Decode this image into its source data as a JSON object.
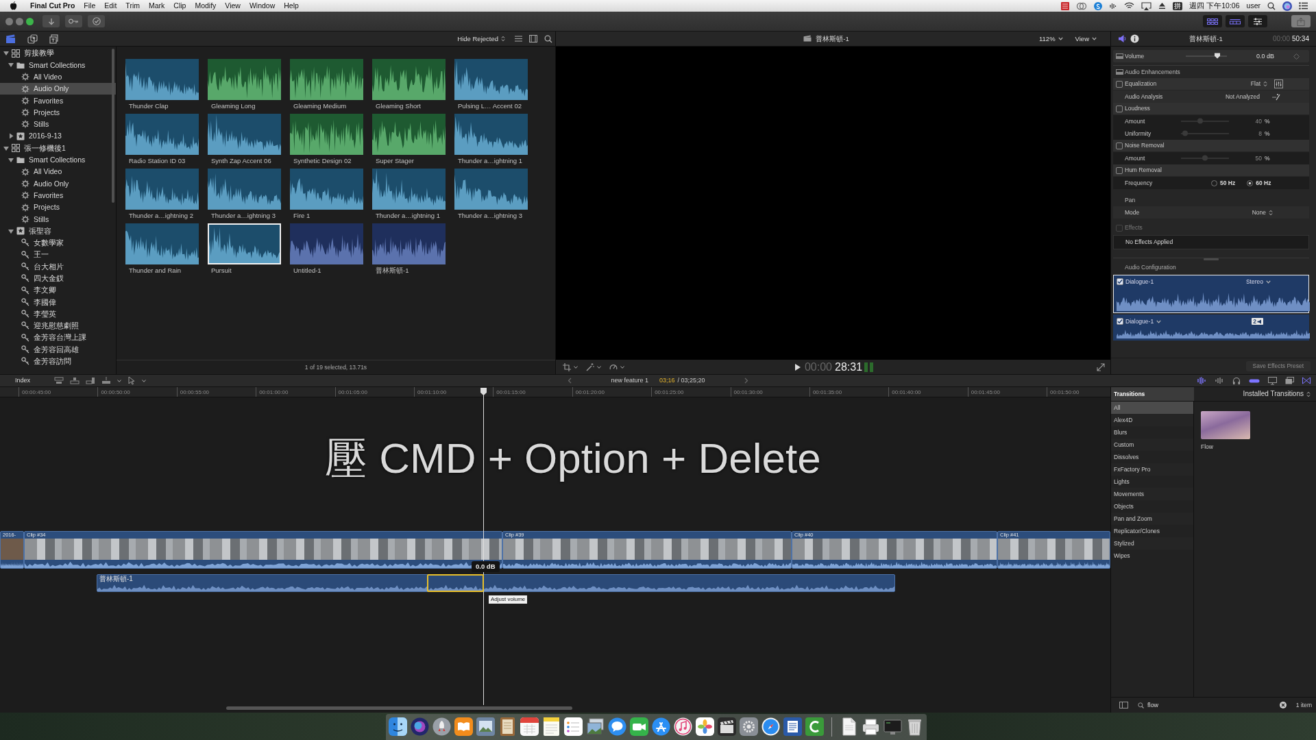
{
  "menu_bar": {
    "app_name": "Final Cut Pro",
    "menus": [
      "File",
      "Edit",
      "Trim",
      "Mark",
      "Clip",
      "Modify",
      "View",
      "Window",
      "Help"
    ],
    "input_method": "拼",
    "clock": "週四 下午10:06",
    "user": "user"
  },
  "libraries": [
    {
      "label": "剪接教學",
      "kind": "library",
      "expanded": true,
      "selected": false,
      "children": [
        {
          "label": "Smart Collections",
          "kind": "folder",
          "expanded": true,
          "selected": false,
          "children": [
            {
              "label": "All Video",
              "kind": "smart",
              "selected": false
            },
            {
              "label": "Audio Only",
              "kind": "smart",
              "selected": true
            },
            {
              "label": "Favorites",
              "kind": "smart",
              "selected": false
            },
            {
              "label": "Projects",
              "kind": "smart",
              "selected": false
            },
            {
              "label": "Stills",
              "kind": "smart",
              "selected": false
            }
          ]
        },
        {
          "label": "2016-9-13",
          "kind": "event",
          "expanded": false,
          "selected": false
        }
      ]
    },
    {
      "label": "張一修機後1",
      "kind": "library",
      "expanded": true,
      "selected": false,
      "children": [
        {
          "label": "Smart Collections",
          "kind": "folder",
          "expanded": true,
          "selected": false,
          "children": [
            {
              "label": "All Video",
              "kind": "smart",
              "selected": false
            },
            {
              "label": "Audio Only",
              "kind": "smart",
              "selected": false
            },
            {
              "label": "Favorites",
              "kind": "smart",
              "selected": false
            },
            {
              "label": "Projects",
              "kind": "smart",
              "selected": false
            },
            {
              "label": "Stills",
              "kind": "smart",
              "selected": false
            }
          ]
        },
        {
          "label": "張聖容",
          "kind": "event",
          "expanded": true,
          "selected": false,
          "children": [
            {
              "label": "女數學家",
              "kind": "keyword",
              "selected": false
            },
            {
              "label": "王一",
              "kind": "keyword",
              "selected": false
            },
            {
              "label": "台大相片",
              "kind": "keyword",
              "selected": false
            },
            {
              "label": "四大金釵",
              "kind": "keyword",
              "selected": false
            },
            {
              "label": "李文卿",
              "kind": "keyword",
              "selected": false
            },
            {
              "label": "李國偉",
              "kind": "keyword",
              "selected": false
            },
            {
              "label": "李瑩英",
              "kind": "keyword",
              "selected": false
            },
            {
              "label": "迎兆慰慈劇照",
              "kind": "keyword",
              "selected": false
            },
            {
              "label": "金芳容台灣上課",
              "kind": "keyword",
              "selected": false
            },
            {
              "label": "金芳容回高雄",
              "kind": "keyword",
              "selected": false
            },
            {
              "label": "金芳容訪問",
              "kind": "keyword",
              "selected": false
            }
          ]
        }
      ]
    }
  ],
  "browser": {
    "filter": "Hide Rejected",
    "clips": [
      {
        "name": "Thunder Clap",
        "kind": "effect",
        "selected": false
      },
      {
        "name": "Gleaming Long",
        "kind": "music",
        "selected": false
      },
      {
        "name": "Gleaming Medium",
        "kind": "music",
        "selected": false
      },
      {
        "name": "Gleaming Short",
        "kind": "music",
        "selected": false
      },
      {
        "name": "Pulsing L… Accent 02",
        "kind": "effect",
        "selected": false
      },
      {
        "name": "Radio Station ID 03",
        "kind": "effect",
        "selected": false
      },
      {
        "name": "Synth Zap Accent 06",
        "kind": "effect",
        "selected": false
      },
      {
        "name": "Synthetic Design 02",
        "kind": "music",
        "selected": false
      },
      {
        "name": "Super Stager",
        "kind": "music",
        "selected": false
      },
      {
        "name": "Thunder a…ightning 1",
        "kind": "effect",
        "selected": false
      },
      {
        "name": "Thunder a…ightning 2",
        "kind": "effect",
        "selected": false
      },
      {
        "name": "Thunder a…ightning 3",
        "kind": "effect",
        "selected": false
      },
      {
        "name": "Fire 1",
        "kind": "effect",
        "selected": false
      },
      {
        "name": "Thunder a…ightning 1",
        "kind": "effect",
        "selected": false
      },
      {
        "name": "Thunder a…ightning 3",
        "kind": "effect",
        "selected": false
      },
      {
        "name": "Thunder and Rain",
        "kind": "effect",
        "selected": false
      },
      {
        "name": "Pursuit",
        "kind": "effect",
        "selected": true
      },
      {
        "name": "Untitled-1",
        "kind": "project",
        "selected": false
      },
      {
        "name": "普林斯頓-1",
        "kind": "project",
        "selected": false
      }
    ],
    "status": "1 of 19 selected, 13.71s"
  },
  "viewer": {
    "title": "普林斯頓-1",
    "zoom": "112%",
    "view_menu": "View",
    "timecode_prefix": "00:00",
    "timecode": "28:31"
  },
  "inspector": {
    "title": "普林斯頓-1",
    "timecode_prefix": "00:00",
    "timecode": "50:34",
    "volume": {
      "label": "Volume",
      "level": 0.77,
      "reading": "0.0 dB"
    },
    "rows": [
      {
        "kind": "section",
        "label": "Audio Enhancements",
        "collapsible": true
      },
      {
        "kind": "check",
        "label": "Equalization",
        "checked": false,
        "disabled": false,
        "value": "Flat"
      },
      {
        "kind": "info",
        "label": "Audio Analysis",
        "value": "Not Analyzed"
      },
      {
        "kind": "check",
        "label": "Loudness",
        "checked": false,
        "disabled": false
      },
      {
        "kind": "slider",
        "label": "Amount",
        "level": 0.4,
        "value": "40",
        "unit": "%"
      },
      {
        "kind": "slider",
        "label": "Uniformity",
        "level": 0.08,
        "value": "8",
        "unit": "%"
      },
      {
        "kind": "check",
        "label": "Noise Removal",
        "checked": false,
        "disabled": false
      },
      {
        "kind": "slider",
        "label": "Amount",
        "level": 0.5,
        "value": "50",
        "unit": "%"
      },
      {
        "kind": "check",
        "label": "Hum Removal",
        "checked": false,
        "disabled": false
      },
      {
        "kind": "radio",
        "label": "Frequency",
        "options": [
          {
            "label": "50 Hz",
            "selected": false
          },
          {
            "label": "60 Hz",
            "selected": true
          }
        ]
      },
      {
        "kind": "section",
        "label": "Pan",
        "collapsible": false
      },
      {
        "kind": "popup",
        "label": "Mode",
        "value": "None"
      },
      {
        "kind": "check",
        "label": "Effects",
        "checked": false,
        "disabled": true
      },
      {
        "kind": "note",
        "label": "No Effects Applied"
      }
    ],
    "audio_configuration": {
      "label": "Audio Configuration",
      "channels": [
        {
          "name": "Dialogue-1",
          "checked": true,
          "selected": true,
          "format": "Stereo"
        },
        {
          "name": "Dialogue-1",
          "checked": true,
          "selected": false,
          "badge": "2"
        }
      ]
    },
    "save_preset": {
      "label": "Save Effects Preset",
      "disabled": true
    }
  },
  "timeline": {
    "index": "Index",
    "project": "new feature 1",
    "position": "03;16",
    "duration": "/ 03;25;20",
    "ruler": [
      "00:00:45:00",
      "00:00:50:00",
      "00:00:55:00",
      "00:01:00:00",
      "00:01:05:00",
      "00:01:10:00",
      "00:01:15:00",
      "00:01:20:00",
      "00:01:25:00",
      "00:01:30:00",
      "00:01:35:00",
      "00:01:40:00",
      "00:01:45:00",
      "00:01:50:00"
    ],
    "caption": "壓 CMD + Option + Delete",
    "clips": [
      {
        "name": "2016-"
      },
      {
        "name": "Clip #34"
      },
      {
        "name": "Clip #39"
      },
      {
        "name": "Clip #40"
      },
      {
        "name": "Clip #41"
      }
    ],
    "connected_clip": {
      "name": "普林斯頓-1",
      "range_selected": true,
      "volume": "0.0 dB",
      "tooltip": "Adjust volume"
    }
  },
  "transitions": {
    "title": "Transitions",
    "source": "Installed Transitions",
    "categories": [
      {
        "label": "All",
        "selected": true
      },
      {
        "label": "Alex4D",
        "selected": false
      },
      {
        "label": "Blurs",
        "selected": false
      },
      {
        "label": "Custom",
        "selected": false
      },
      {
        "label": "Dissolves",
        "selected": false
      },
      {
        "label": "FxFactory Pro",
        "selected": false
      },
      {
        "label": "Lights",
        "selected": false
      },
      {
        "label": "Movements",
        "selected": false
      },
      {
        "label": "Objects",
        "selected": false
      },
      {
        "label": "Pan and Zoom",
        "selected": false
      },
      {
        "label": "Replicator/Clones",
        "selected": false
      },
      {
        "label": "Stylized",
        "selected": false
      },
      {
        "label": "Wipes",
        "selected": false
      }
    ],
    "items": [
      {
        "name": "Flow"
      }
    ],
    "search": "flow",
    "count": "1 item"
  }
}
